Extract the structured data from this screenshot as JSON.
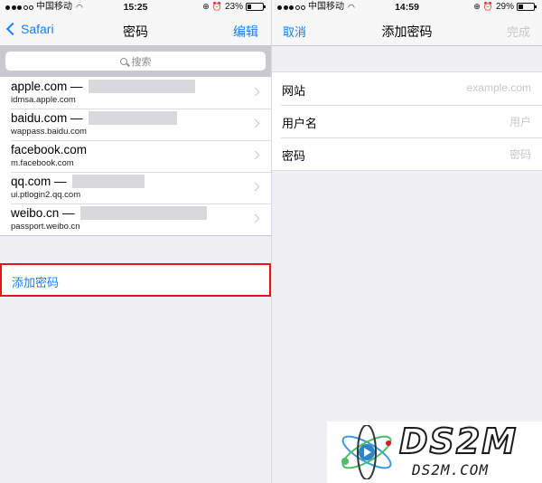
{
  "left": {
    "status": {
      "carrier": "中国移动",
      "time": "15:25",
      "battery": "23%",
      "battery_level": 0.23
    },
    "nav": {
      "back": "Safari",
      "title": "密码",
      "edit": "编辑"
    },
    "search": {
      "placeholder": "搜索"
    },
    "items": [
      {
        "site": "apple.com —",
        "sub": "idmsa.apple.com"
      },
      {
        "site": "baidu.com —",
        "sub": "wappass.baidu.com"
      },
      {
        "site": "facebook.com",
        "sub": "m.facebook.com"
      },
      {
        "site": "qq.com —",
        "sub": "ui.ptlogin2.qq.com"
      },
      {
        "site": "weibo.cn —",
        "sub": "passport.weibo.cn"
      }
    ],
    "add_label": "添加密码"
  },
  "right": {
    "status": {
      "carrier": "中国移动",
      "time": "14:59",
      "battery": "29%",
      "battery_level": 0.29
    },
    "nav": {
      "cancel": "取消",
      "title": "添加密码",
      "done": "完成"
    },
    "fields": [
      {
        "label": "网站",
        "placeholder": "example.com"
      },
      {
        "label": "用户名",
        "placeholder": "用户"
      },
      {
        "label": "密码",
        "placeholder": "密码"
      }
    ]
  },
  "watermark": {
    "big": "DS2M",
    "small": "DS2M.COM"
  },
  "colors": {
    "accent": "#157efb",
    "highlight": "#e0161b",
    "background": "#efeff4"
  }
}
